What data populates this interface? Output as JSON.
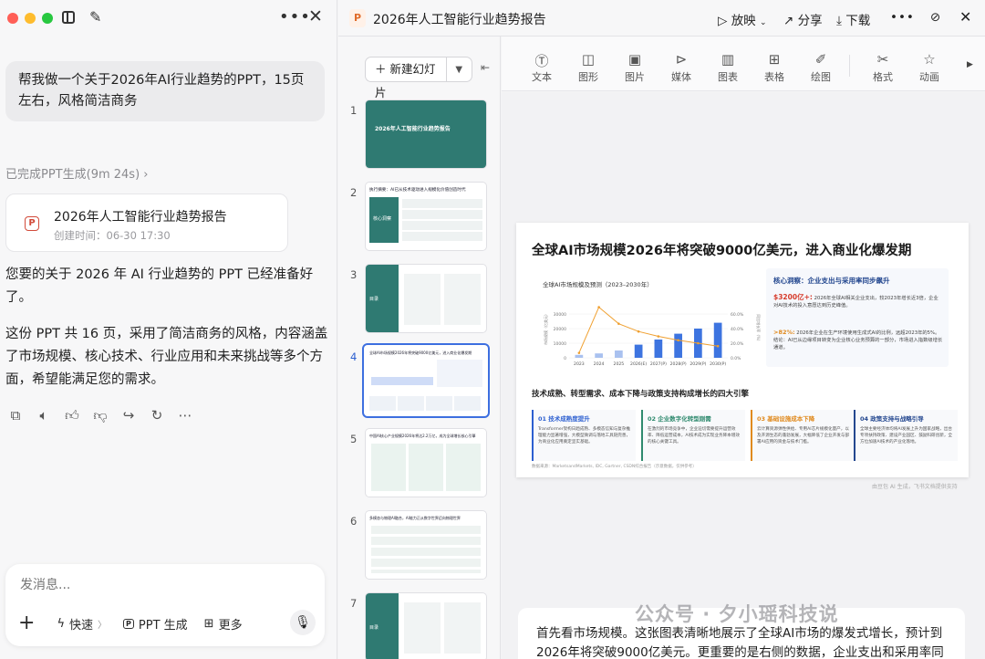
{
  "chat": {
    "user_message": "帮我做一个关于2026年AI行业趋势的PPT，15页左右，风格简洁商务",
    "status": "已完成PPT生成(9m 24s)",
    "file_card": {
      "title": "2026年人工智能行业趋势报告",
      "created": "创建时间：06-30 17:30"
    },
    "reply_p1": "您要的关于 2026 年 AI 行业趋势的 PPT 已经准备好了。",
    "reply_p2": "这份 PPT 共 16 页，采用了简洁商务的风格，内容涵盖了市场规模、核心技术、行业应用和未来挑战等多个方面，希望能满足您的需求。",
    "composer": {
      "placeholder": "发消息...",
      "quick": "快速",
      "ppt": "PPT 生成",
      "more": "更多"
    }
  },
  "header": {
    "doc_title": "2026年人工智能行业趋势报告",
    "play": "放映",
    "share": "分享",
    "download": "下载"
  },
  "slides_panel": {
    "new_slide": "新建幻灯片",
    "thumbs": [
      {
        "num": "1",
        "title": "2026年人工智能行业趋势报告"
      },
      {
        "num": "2",
        "title": "执行摘要：AI已从技术驱动进入规模化价值创造时代",
        "side": "核心洞察"
      },
      {
        "num": "3",
        "side": "目录"
      },
      {
        "num": "4",
        "title": "全球AI市场规模2026年将突破9000亿美元，进入商业化爆发期"
      },
      {
        "num": "5",
        "title": "中国AI核心产业规模2026年将达2.2万亿，成为全球增长核心引擎"
      },
      {
        "num": "6",
        "title": "多模态与物理AI融合，AI能力正从数字世界迈向物理世界"
      },
      {
        "num": "7",
        "side": "目录"
      }
    ]
  },
  "toolbar": [
    "文本",
    "图形",
    "图片",
    "媒体",
    "图表",
    "表格",
    "绘图",
    "格式",
    "动画"
  ],
  "slide": {
    "title": "全球AI市场规模2026年将突破9000亿美元，进入商业化爆发期",
    "chart_title": "全球AI市场规模及预测（2023–2030年）",
    "insight_title": "核心洞察：企业支出与采用率同步飙升",
    "insight_1_hl": "$3200亿+:",
    "insight_1": "2026年全球AI相关企业支出，较2023年增长近3倍，企业对AI技术的投入意愿达到历史峰值。",
    "insight_2_hl": ">82%:",
    "insight_2": "2026年企业在生产环境使用生成式AI的比例，远超2023年的5%。结论：AI已从边缘项目转变为企业核心业务预算的一部分，市场进入指数级增长通道。",
    "section_title": "技术成熟、转型需求、成本下降与政策支持构成增长的四大引擎",
    "cards": [
      {
        "title": "01 技术成熟度提升",
        "body": "Transformer架构日趋成熟、多模态信知与复杂推理能力显著增强，大模型微调与落地工具链完善，为商业化应用奠定坚实基础。",
        "color": "#2c5fd0"
      },
      {
        "title": "02 企业数字化转型刚需",
        "body": "在激烈的市场竞争中，企业迫切需要提升运营效率、降低运营成本，AI技术成为实现业务降本增效的核心关键工具。",
        "color": "#2f8a6e"
      },
      {
        "title": "03 基础设施成本下降",
        "body": "云计算资源弹性供给、专用AI芯片规模化量产，以及开源生态的蓬勃发展，大幅降低了企业开发与部署AI应用的资金与技术门槛。",
        "color": "#e08a1e"
      },
      {
        "title": "04 政策支持与战略引导",
        "body": "全球主要经济体均将AI发展上升为国家战略，出台专项扶持政策、建设产业园区、鼓励科研创新，全方位加速AI技术的产业化落地。",
        "color": "#23478f"
      }
    ],
    "source": "数据来源：MarketsandMarkets, IDC, Gartner, CSDN综合报告（示意数据，仅供参考）",
    "footnote": "由豆包 AI 生成，飞书文档提供支持"
  },
  "chart_data": {
    "type": "bar",
    "title": "全球AI市场规模及预测（2023–2030年）",
    "categories": [
      "2023",
      "2024",
      "2025",
      "2026(E)",
      "2027(P)",
      "2028(P)",
      "2029(P)",
      "2030(P)"
    ],
    "series": [
      {
        "name": "市场规模(亿美元)",
        "type": "bar",
        "values": [
          2000,
          3000,
          5000,
          9000,
          12500,
          16500,
          20000,
          24000
        ]
      },
      {
        "name": "同比增长率(%)",
        "type": "line",
        "values": [
          5,
          52,
          35,
          27,
          22,
          18,
          15,
          12
        ]
      }
    ],
    "ylim": [
      0,
      40000
    ],
    "y_ticks": [
      "0",
      "10000",
      "20000",
      "30000"
    ],
    "y2_ticks": [
      "0.0%",
      "20.0%",
      "40.0%",
      "60.0%"
    ],
    "ylabel": "市场规模（亿美元）",
    "y2label": "同比增长率（%）"
  },
  "article": {
    "text": "首先看市场规模。这张图表清晰地展示了全球AI市场的爆发式增长，预计到2026年将突破9000亿美元。更重要的是右侧的数据，企业支出和采用率同步",
    "watermark": "公众号 · 夕小瑶科技说"
  }
}
